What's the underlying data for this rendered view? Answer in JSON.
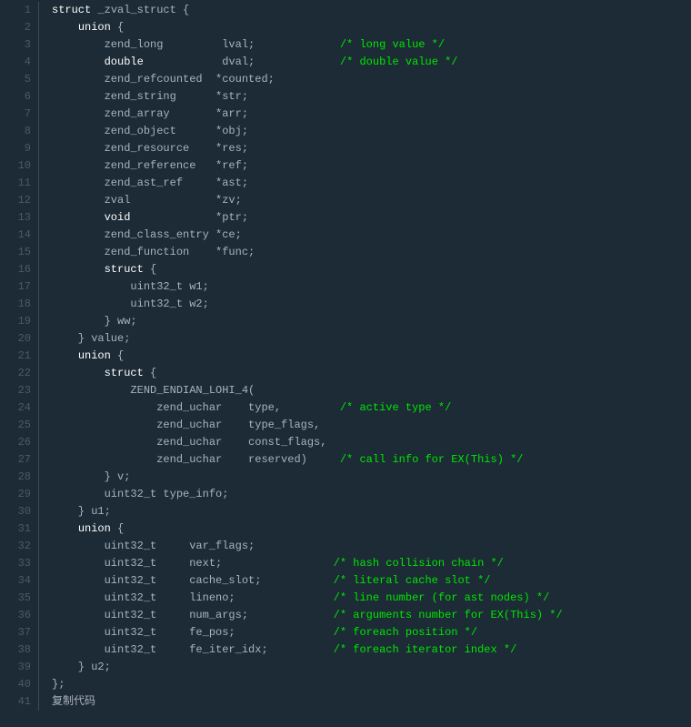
{
  "copy_label": "复制代码",
  "code": [
    {
      "spans": [
        {
          "t": "struct",
          "c": "kw"
        },
        {
          "t": " _zval_struct {",
          "c": "txt"
        }
      ]
    },
    {
      "spans": [
        {
          "t": "    ",
          "c": "txt"
        },
        {
          "t": "union",
          "c": "kw"
        },
        {
          "t": " {",
          "c": "txt"
        }
      ]
    },
    {
      "spans": [
        {
          "t": "        zend_long         lval;             ",
          "c": "txt"
        },
        {
          "t": "/* long value */",
          "c": "cmt"
        }
      ]
    },
    {
      "spans": [
        {
          "t": "        ",
          "c": "txt"
        },
        {
          "t": "double",
          "c": "kw"
        },
        {
          "t": "            dval;             ",
          "c": "txt"
        },
        {
          "t": "/* double value */",
          "c": "cmt"
        }
      ]
    },
    {
      "spans": [
        {
          "t": "        zend_refcounted  *counted;",
          "c": "txt"
        }
      ]
    },
    {
      "spans": [
        {
          "t": "        zend_string      *str;",
          "c": "txt"
        }
      ]
    },
    {
      "spans": [
        {
          "t": "        zend_array       *arr;",
          "c": "txt"
        }
      ]
    },
    {
      "spans": [
        {
          "t": "        zend_object      *obj;",
          "c": "txt"
        }
      ]
    },
    {
      "spans": [
        {
          "t": "        zend_resource    *res;",
          "c": "txt"
        }
      ]
    },
    {
      "spans": [
        {
          "t": "        zend_reference   *ref;",
          "c": "txt"
        }
      ]
    },
    {
      "spans": [
        {
          "t": "        zend_ast_ref     *ast;",
          "c": "txt"
        }
      ]
    },
    {
      "spans": [
        {
          "t": "        zval             *zv;",
          "c": "txt"
        }
      ]
    },
    {
      "spans": [
        {
          "t": "        ",
          "c": "txt"
        },
        {
          "t": "void",
          "c": "kw"
        },
        {
          "t": "             *ptr;",
          "c": "txt"
        }
      ]
    },
    {
      "spans": [
        {
          "t": "        zend_class_entry *ce;",
          "c": "txt"
        }
      ]
    },
    {
      "spans": [
        {
          "t": "        zend_function    *func;",
          "c": "txt"
        }
      ]
    },
    {
      "spans": [
        {
          "t": "        ",
          "c": "txt"
        },
        {
          "t": "struct",
          "c": "kw"
        },
        {
          "t": " {",
          "c": "txt"
        }
      ]
    },
    {
      "spans": [
        {
          "t": "            uint32_t w1;",
          "c": "txt"
        }
      ]
    },
    {
      "spans": [
        {
          "t": "            uint32_t w2;",
          "c": "txt"
        }
      ]
    },
    {
      "spans": [
        {
          "t": "        } ww;",
          "c": "txt"
        }
      ]
    },
    {
      "spans": [
        {
          "t": "    } value;",
          "c": "txt"
        }
      ]
    },
    {
      "spans": [
        {
          "t": "    ",
          "c": "txt"
        },
        {
          "t": "union",
          "c": "kw"
        },
        {
          "t": " {",
          "c": "txt"
        }
      ]
    },
    {
      "spans": [
        {
          "t": "        ",
          "c": "txt"
        },
        {
          "t": "struct",
          "c": "kw"
        },
        {
          "t": " {",
          "c": "txt"
        }
      ]
    },
    {
      "spans": [
        {
          "t": "            ZEND_ENDIAN_LOHI_4(",
          "c": "txt"
        }
      ]
    },
    {
      "spans": [
        {
          "t": "                zend_uchar    type,         ",
          "c": "txt"
        },
        {
          "t": "/* active type */",
          "c": "cmt"
        }
      ]
    },
    {
      "spans": [
        {
          "t": "                zend_uchar    type_flags,",
          "c": "txt"
        }
      ]
    },
    {
      "spans": [
        {
          "t": "                zend_uchar    const_flags,",
          "c": "txt"
        }
      ]
    },
    {
      "spans": [
        {
          "t": "                zend_uchar    reserved)     ",
          "c": "txt"
        },
        {
          "t": "/* call info for EX(This) */",
          "c": "cmt"
        }
      ]
    },
    {
      "spans": [
        {
          "t": "        } v;",
          "c": "txt"
        }
      ]
    },
    {
      "spans": [
        {
          "t": "        uint32_t type_info;",
          "c": "txt"
        }
      ]
    },
    {
      "spans": [
        {
          "t": "    } u1;",
          "c": "txt"
        }
      ]
    },
    {
      "spans": [
        {
          "t": "    ",
          "c": "txt"
        },
        {
          "t": "union",
          "c": "kw"
        },
        {
          "t": " {",
          "c": "txt"
        }
      ]
    },
    {
      "spans": [
        {
          "t": "        uint32_t     var_flags;",
          "c": "txt"
        }
      ]
    },
    {
      "spans": [
        {
          "t": "        uint32_t     next;                 ",
          "c": "txt"
        },
        {
          "t": "/* hash collision chain */",
          "c": "cmt"
        }
      ]
    },
    {
      "spans": [
        {
          "t": "        uint32_t     cache_slot;           ",
          "c": "txt"
        },
        {
          "t": "/* literal cache slot */",
          "c": "cmt"
        }
      ]
    },
    {
      "spans": [
        {
          "t": "        uint32_t     lineno;               ",
          "c": "txt"
        },
        {
          "t": "/* line number (for ast nodes) */",
          "c": "cmt"
        }
      ]
    },
    {
      "spans": [
        {
          "t": "        uint32_t     num_args;             ",
          "c": "txt"
        },
        {
          "t": "/* arguments number for EX(This) */",
          "c": "cmt"
        }
      ]
    },
    {
      "spans": [
        {
          "t": "        uint32_t     fe_pos;               ",
          "c": "txt"
        },
        {
          "t": "/* foreach position */",
          "c": "cmt"
        }
      ]
    },
    {
      "spans": [
        {
          "t": "        uint32_t     fe_iter_idx;          ",
          "c": "txt"
        },
        {
          "t": "/* foreach iterator index */",
          "c": "cmt"
        }
      ]
    },
    {
      "spans": [
        {
          "t": "    } u2;",
          "c": "txt"
        }
      ]
    },
    {
      "spans": [
        {
          "t": "};",
          "c": "txt"
        }
      ]
    }
  ]
}
